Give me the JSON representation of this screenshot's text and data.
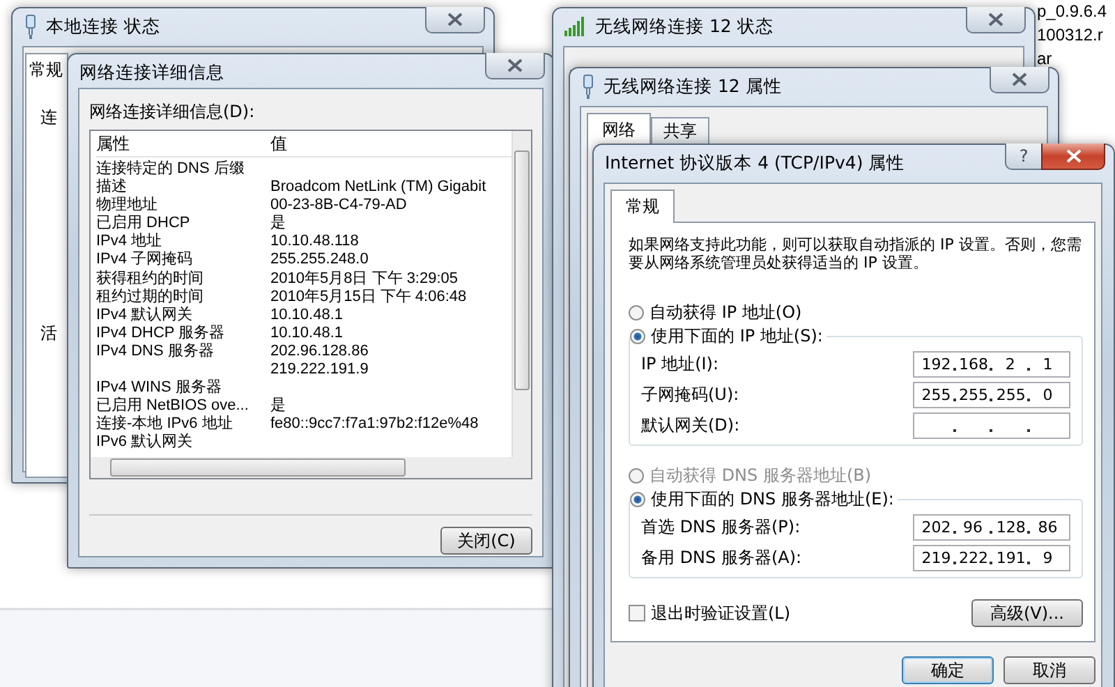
{
  "desktop_file": {
    "name_lines": [
      "p_0.9.6.4",
      "100312.r",
      "ar"
    ]
  },
  "local_status_window": {
    "title": "本地连接 状态",
    "tabs": [
      {
        "label": "常规",
        "selected": true
      }
    ],
    "texts": [
      "连",
      "活"
    ]
  },
  "details_window": {
    "title": "网络连接详细信息",
    "list_label": "网络连接详细信息(D):",
    "columns": [
      "属性",
      "值"
    ],
    "rows": [
      {
        "property": "连接特定的 DNS 后缀"
      },
      {
        "property": "描述",
        "value": "Broadcom NetLink (TM) Gigabit"
      },
      {
        "property": "物理地址",
        "value": "00-23-8B-C4-79-AD"
      },
      {
        "property": "已启用 DHCP",
        "value": "是"
      },
      {
        "property": "IPv4 地址",
        "value": "10.10.48.118"
      },
      {
        "property": "IPv4 子网掩码",
        "value": "255.255.248.0"
      },
      {
        "property": "获得租约的时间",
        "value": "2010年5月8日 下午 3:29:05"
      },
      {
        "property": "租约过期的时间",
        "value": "2010年5月15日 下午 4:06:48"
      },
      {
        "property": "IPv4 默认网关",
        "value": "10.10.48.1"
      },
      {
        "property": "IPv4 DHCP 服务器",
        "value": "10.10.48.1"
      },
      {
        "property": "IPv4 DNS 服务器",
        "value": "202.96.128.86"
      },
      {
        "value": "219.222.191.9"
      },
      {
        "property": "IPv4 WINS 服务器"
      },
      {
        "property": "已启用 NetBIOS ove...",
        "value": "是"
      },
      {
        "property": "连接-本地 IPv6 地址",
        "value": "fe80::9cc7:f7a1:97b2:f12e%48"
      },
      {
        "property": "IPv6 默认网关"
      }
    ],
    "close_button": "关闭(C)"
  },
  "wireless_status_window": {
    "title": "无线网络连接 12 状态"
  },
  "wireless_properties_window": {
    "title": "无线网络连接 12 属性",
    "tabs": [
      {
        "label": "网络",
        "selected": true
      },
      {
        "label": "共享",
        "selected": false
      }
    ]
  },
  "ipv4_window": {
    "title": "Internet 协议版本 4 (TCP/IPv4) 属性",
    "help_button": "?",
    "tabs": [
      {
        "label": "常规",
        "selected": true
      }
    ],
    "description": "如果网络支持此功能，则可以获取自动指派的 IP 设置。否则，您需要从网络系统管理员处获得适当的 IP 设置。",
    "ip_options": [
      {
        "label": "自动获得 IP 地址(O)",
        "selected": false,
        "disabled": false
      },
      {
        "label": "使用下面的 IP 地址(S):",
        "selected": true,
        "disabled": false
      }
    ],
    "ip_fields": [
      {
        "label": "IP 地址(I):",
        "octets": [
          "192",
          "168",
          "2",
          "1"
        ]
      },
      {
        "label": "子网掩码(U):",
        "octets": [
          "255",
          "255",
          "255",
          "0"
        ]
      },
      {
        "label": "默认网关(D):"
      }
    ],
    "dns_options": [
      {
        "label": "自动获得 DNS 服务器地址(B)",
        "selected": false,
        "disabled": true
      },
      {
        "label": "使用下面的 DNS 服务器地址(E):",
        "selected": true,
        "disabled": false
      }
    ],
    "dns_fields": [
      {
        "label": "首选 DNS 服务器(P):",
        "octets": [
          "202",
          "96",
          "128",
          "86"
        ]
      },
      {
        "label": "备用 DNS 服务器(A):",
        "octets": [
          "219",
          "222",
          "191",
          "9"
        ]
      }
    ],
    "validate_checkbox": {
      "label": "退出时验证设置(L)",
      "checked": false
    },
    "advanced_button": "高级(V)...",
    "buttons": [
      "确定",
      "取消"
    ]
  }
}
